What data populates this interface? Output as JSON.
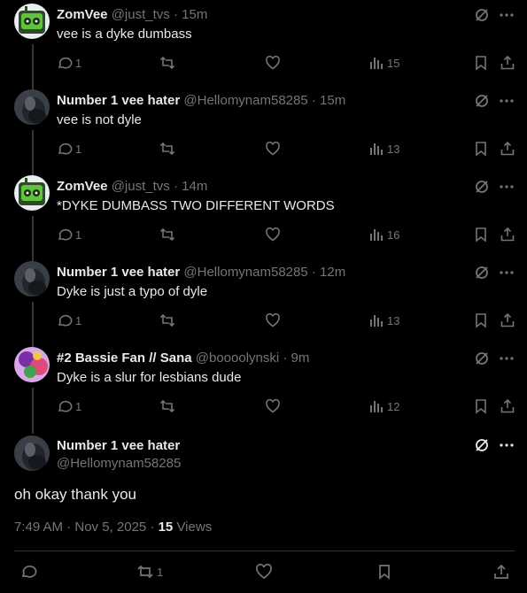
{
  "replies": [
    {
      "name": "ZomVee",
      "handle": "@just_tvs",
      "time": "15m",
      "text": "vee is a dyke dumbass",
      "replies": "1",
      "reposts": "",
      "likes": "",
      "views": "15",
      "avatar": "robot-green"
    },
    {
      "name": "Number 1 vee hater",
      "handle": "@Hellomynam58285",
      "time": "15m",
      "text": "vee is not dyle",
      "replies": "1",
      "reposts": "",
      "likes": "",
      "views": "13",
      "avatar": "dark-creature"
    },
    {
      "name": "ZomVee",
      "handle": "@just_tvs",
      "time": "14m",
      "text": "*DYKE DUMBASS TWO DIFFERENT WORDS",
      "replies": "1",
      "reposts": "",
      "likes": "",
      "views": "16",
      "avatar": "robot-green"
    },
    {
      "name": "Number 1 vee hater",
      "handle": "@Hellomynam58285",
      "time": "12m",
      "text": "Dyke is just a typo of dyle",
      "replies": "1",
      "reposts": "",
      "likes": "",
      "views": "13",
      "avatar": "dark-creature"
    },
    {
      "name": "#2 Bassie Fan // Sana",
      "handle": "@boooolynski",
      "time": "9m",
      "text": "Dyke is a slur for lesbians dude",
      "replies": "1",
      "reposts": "",
      "likes": "",
      "views": "12",
      "avatar": "colorful-art"
    }
  ],
  "main_post": {
    "name": "Number 1 vee hater",
    "handle": "@Hellomynam58285",
    "text": "oh okay thank you",
    "timestamp": "7:49 AM · Nov 5, 2025 · ",
    "views_count": "15",
    "views_label": " Views",
    "reposts": "1",
    "avatar": "dark-creature"
  },
  "separator": "·",
  "colors": {
    "background": "#000000",
    "text": "#e7e9ea",
    "muted": "#71767b",
    "line": "#333639"
  }
}
